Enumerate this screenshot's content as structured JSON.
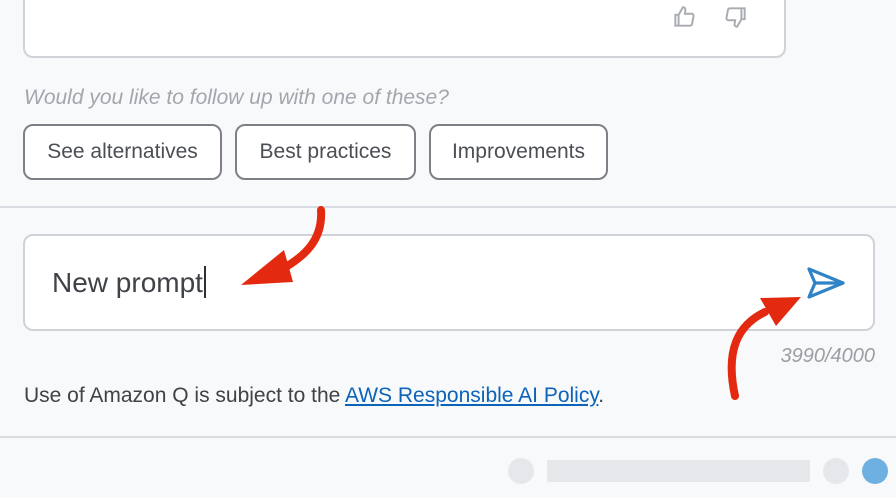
{
  "previous_response": {
    "thumbs_up_icon": "thumbs-up-icon",
    "thumbs_down_icon": "thumbs-down-icon"
  },
  "followup": {
    "label": "Would you like to follow up with one of these?",
    "chips": [
      "See alternatives",
      "Best practices",
      "Improvements"
    ]
  },
  "prompt": {
    "value": "New prompt",
    "send_icon": "send-icon",
    "counter": "3990/4000"
  },
  "disclaimer": {
    "prefix": "Use of Amazon Q is subject to the ",
    "link": "AWS Responsible AI Policy",
    "suffix": "."
  },
  "colors": {
    "accent": "#2f84c8",
    "annotation_arrow": "#e32a10",
    "link": "#0b64b8"
  }
}
